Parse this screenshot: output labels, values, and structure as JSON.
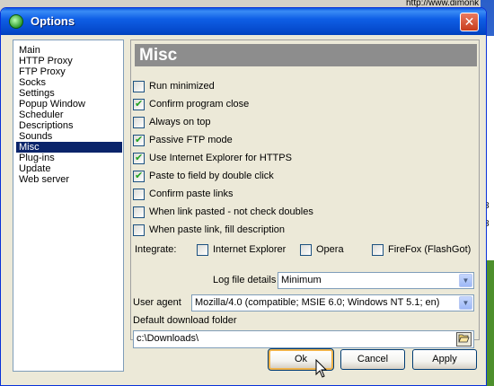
{
  "background": {
    "url_fragment": "http://www.dimonk",
    "right_digits": [
      "8",
      "8"
    ]
  },
  "window": {
    "title": "Options",
    "close_glyph": "✕"
  },
  "categories": [
    {
      "label": "Main",
      "selected": false
    },
    {
      "label": "HTTP Proxy",
      "selected": false
    },
    {
      "label": "FTP Proxy",
      "selected": false
    },
    {
      "label": "Socks",
      "selected": false
    },
    {
      "label": "Settings",
      "selected": false
    },
    {
      "label": "Popup Window",
      "selected": false
    },
    {
      "label": "Scheduler",
      "selected": false
    },
    {
      "label": "Descriptions",
      "selected": false
    },
    {
      "label": "Sounds",
      "selected": false
    },
    {
      "label": "Misc",
      "selected": true
    },
    {
      "label": "Plug-ins",
      "selected": false
    },
    {
      "label": "Update",
      "selected": false
    },
    {
      "label": "Web server",
      "selected": false
    }
  ],
  "panel": {
    "header": "Misc",
    "options": [
      {
        "label": "Run minimized",
        "checked": false
      },
      {
        "label": "Confirm program close",
        "checked": true
      },
      {
        "label": "Always on top",
        "checked": false
      },
      {
        "label": "Passive FTP mode",
        "checked": true
      },
      {
        "label": "Use Internet Explorer for HTTPS",
        "checked": true
      },
      {
        "label": "Paste to field by double click",
        "checked": true
      },
      {
        "label": "Confirm paste links",
        "checked": false
      },
      {
        "label": "When link pasted - not check doubles",
        "checked": false
      },
      {
        "label": "When paste link, fill description",
        "checked": false
      }
    ],
    "integrate": {
      "label": "Integrate:",
      "browsers": [
        {
          "label": "Internet Explorer",
          "checked": false
        },
        {
          "label": "Opera",
          "checked": false
        },
        {
          "label": "FireFox (FlashGot)",
          "checked": false
        }
      ]
    },
    "log_file": {
      "label": "Log file details",
      "value": "Minimum"
    },
    "user_agent": {
      "label": "User agent",
      "value": "Mozilla/4.0 (compatible; MSIE 6.0; Windows NT 5.1; en)"
    },
    "download_folder": {
      "label": "Default download folder",
      "value": "c:\\Downloads\\"
    }
  },
  "buttons": {
    "ok": "Ok",
    "cancel": "Cancel",
    "apply": "Apply"
  },
  "colors": {
    "title_bar": "#0447c8",
    "selection": "#0a246a",
    "panel_header": "#8d8d8d",
    "check_mark": "#21a121"
  }
}
